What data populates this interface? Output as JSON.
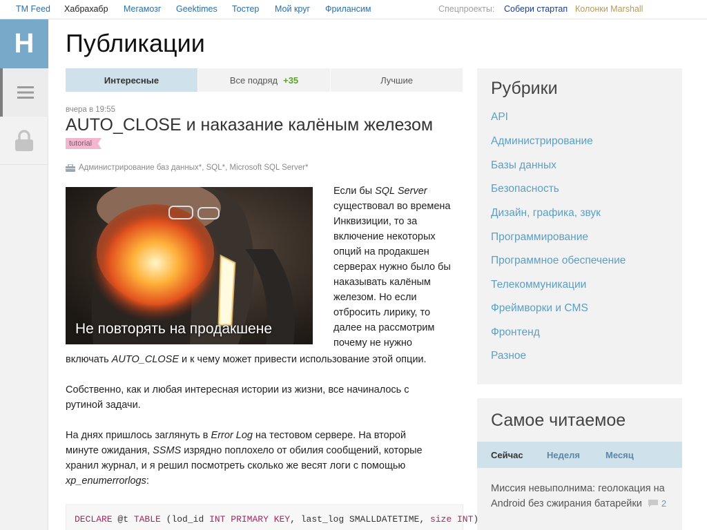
{
  "topnav": {
    "items": [
      "TM Feed",
      "Хабрахабр",
      "Мегамозг",
      "Geektimes",
      "Тостер",
      "Мой круг",
      "Фрилансим"
    ],
    "special_label": "Спецпроекты:",
    "special_1": "Собери стартап",
    "special_2": "Колонки Marshall",
    "accent_link": "#2a6fa8",
    "special_2_color": "#b89a55"
  },
  "leftbar": {
    "logo_letter": "H",
    "logo_color": "#78a9c8"
  },
  "page_title": "Публикации",
  "tabs": {
    "interesting": "Интересные",
    "all": "Все подряд",
    "all_count": "+35",
    "best": "Лучшие"
  },
  "article": {
    "time": "вчера в 19:55",
    "title": "AUTO_CLOSE и наказание калёным железом",
    "tag": "tutorial",
    "hubs": [
      "Администрирование баз данных*",
      "SQL*",
      "Microsoft SQL Server*"
    ],
    "image_caption": "Не повторять на продакшене",
    "side_lines": [
      "Если бы ",
      "SQL Server",
      "существовал во времена",
      "Инквизиции, то за",
      "включение некоторых",
      "опций на продакшен",
      "серверах нужно было бы",
      "наказывать калёным",
      "железом. Но если",
      "отбросить лирику, то",
      "далее на рассмотрим",
      "почему не нужно"
    ],
    "line_12a": "включать ",
    "line_12b": "AUTO_CLOSE",
    "line_12c": " и к чему может привести использование этой опции.",
    "para2_l1": "Собственно, как и любая интересная истории из жизни, все начиналось с",
    "para2_l2": "рутиной задачи.",
    "para3_l1a": "На днях пришлось заглянуть в ",
    "para3_l1b": "Error Log",
    "para3_l1c": " на тестовом сервере. На второй",
    "para3_l2a": "минуте ожидания, ",
    "para3_l2b": "SSMS",
    "para3_l2c": " изрядно поплохело от обилия сообщений, которые",
    "para3_l3": "хранил журнал, и я решил посмотреть сколько же весят логи с помощью",
    "para3_l4a": "xp_enumerrorlogs",
    "para3_l4b": ":",
    "code": {
      "t1": "DECLARE",
      "t2": " @t ",
      "t3": "TABLE",
      "t4": " (lod_id ",
      "t5": "INT",
      "t6": " ",
      "t7": "PRIMARY KEY",
      "t8": ", last_log SMALLDATETIME, ",
      "t9": "size",
      "t10": " ",
      "t11": "INT",
      "t12": ")"
    }
  },
  "rubrics": {
    "title": "Рубрики",
    "items": [
      "API",
      "Администрирование",
      "Базы данных",
      "Безопасность",
      "Дизайн, графика, звук",
      "Программирование",
      "Программное обеспечение",
      "Телекоммуникации",
      "Фреймворки и CMS",
      "Фронтенд",
      "Разное"
    ]
  },
  "mostread": {
    "title": "Самое читаемое",
    "tabs": [
      "Сейчас",
      "Неделя",
      "Месяц"
    ],
    "item_text": "Миссия невыполнима: геолокация на Android без сжирания батарейки",
    "item_comments": "2"
  }
}
